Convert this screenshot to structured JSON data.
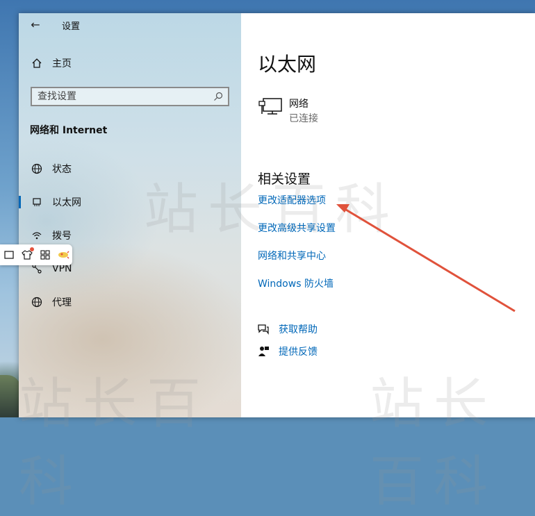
{
  "window": {
    "title": "设置"
  },
  "sidebar": {
    "home_label": "主页",
    "search_placeholder": "查找设置",
    "section_title": "网络和 Internet",
    "items": [
      {
        "label": "状态",
        "icon": "globe-icon",
        "selected": false
      },
      {
        "label": "以太网",
        "icon": "ethernet-icon",
        "selected": true
      },
      {
        "label": "拨号",
        "icon": "dialup-icon",
        "selected": false
      },
      {
        "label": "VPN",
        "icon": "vpn-icon",
        "selected": false
      },
      {
        "label": "代理",
        "icon": "globe-icon",
        "selected": false
      }
    ]
  },
  "main": {
    "page_title": "以太网",
    "network": {
      "name": "网络",
      "status": "已连接"
    },
    "related_title": "相关设置",
    "links": [
      "更改适配器选项",
      "更改高级共享设置",
      "网络和共享中心",
      "Windows 防火墙"
    ],
    "help": [
      {
        "label": "获取帮助",
        "icon": "help-chat-icon"
      },
      {
        "label": "提供反馈",
        "icon": "feedback-icon"
      }
    ]
  },
  "watermark": {
    "text": "站长百科"
  },
  "annotation": {
    "color": "#e0523b"
  },
  "colors": {
    "link": "#0067b8",
    "accent": "#0067b8"
  }
}
